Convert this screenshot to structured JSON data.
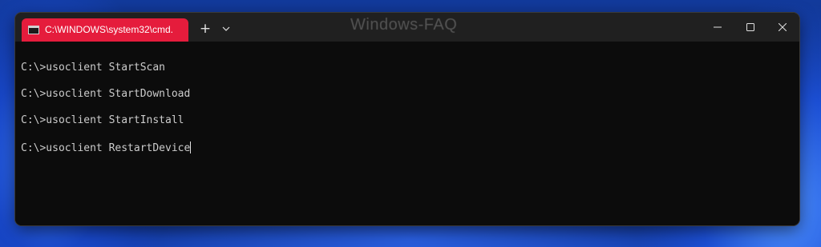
{
  "window": {
    "tab_title": "C:\\WINDOWS\\system32\\cmd.",
    "new_tab_glyph": "+",
    "watermark": "Windows-FAQ",
    "tab_color": "#e51c3c",
    "tab_icon": "cmd-icon",
    "dropdown_icon": "chevron-down-icon",
    "controls": [
      "minimize-icon",
      "maximize-icon",
      "close-icon"
    ]
  },
  "terminal": {
    "lines": [
      "C:\\>usoclient StartScan",
      "C:\\>usoclient StartDownload",
      "C:\\>usoclient StartInstall",
      "C:\\>usoclient RestartDevice"
    ],
    "text_color": "#cccccc",
    "background": "#0c0c0c"
  }
}
